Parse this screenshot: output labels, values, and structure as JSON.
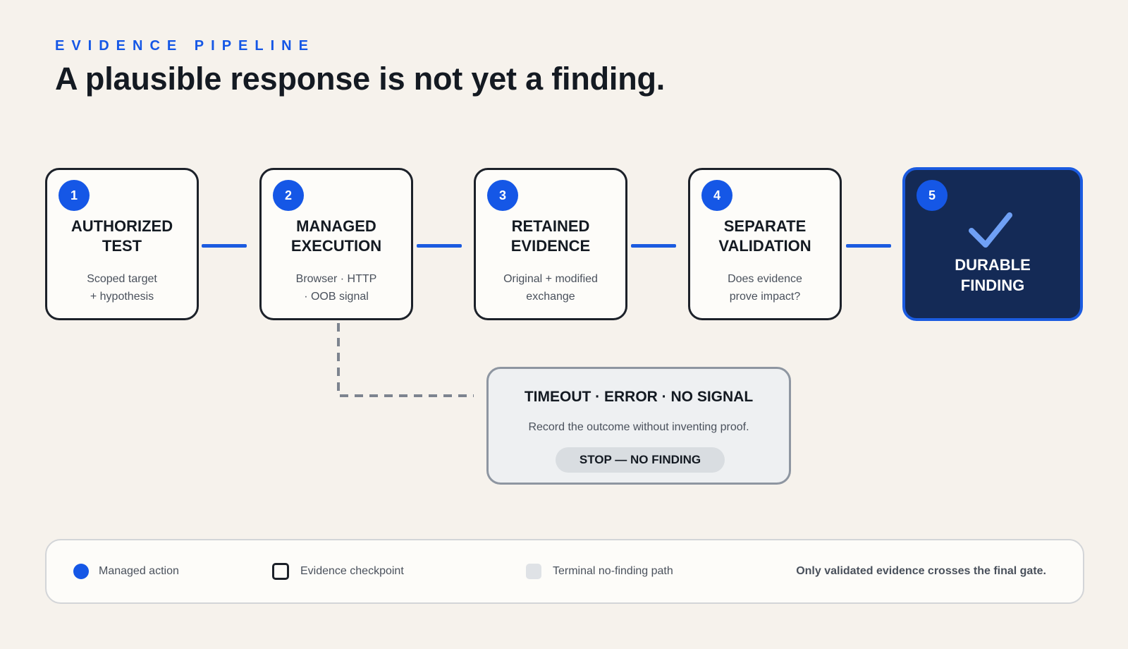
{
  "header": {
    "eyebrow": "EVIDENCE PIPELINE",
    "title": "A plausible response is not yet a finding."
  },
  "steps": [
    {
      "number": "1",
      "title_line1": "AUTHORIZED",
      "title_line2": "TEST",
      "desc_line1": "Scoped target",
      "desc_line2": "+ hypothesis"
    },
    {
      "number": "2",
      "title_line1": "MANAGED",
      "title_line2": "EXECUTION",
      "desc_line1": "Browser · HTTP",
      "desc_line2": "· OOB signal"
    },
    {
      "number": "3",
      "title_line1": "RETAINED",
      "title_line2": "EVIDENCE",
      "desc_line1": "Original + modified",
      "desc_line2": "exchange"
    },
    {
      "number": "4",
      "title_line1": "SEPARATE",
      "title_line2": "VALIDATION",
      "desc_line1": "Does evidence",
      "desc_line2": "prove impact?"
    },
    {
      "number": "5",
      "title_line1": "DURABLE",
      "title_line2": "FINDING",
      "icon": "checkmark-icon"
    }
  ],
  "no_finding": {
    "title": "TIMEOUT · ERROR · NO SIGNAL",
    "description": "Record the outcome without inventing proof.",
    "outcome": "STOP — NO FINDING"
  },
  "legend": {
    "items": [
      {
        "label": "Managed action",
        "swatch": "blue-dot"
      },
      {
        "label": "Evidence checkpoint",
        "swatch": "outlined-box"
      },
      {
        "label": "Terminal no-finding path",
        "swatch": "gray-box"
      }
    ],
    "note": "Only validated evidence crosses the final gate."
  },
  "colors": {
    "background": "#f6f2ec",
    "accent": "#1557e6",
    "final_fill": "#142a56",
    "dashed_path": "#7d848f"
  }
}
